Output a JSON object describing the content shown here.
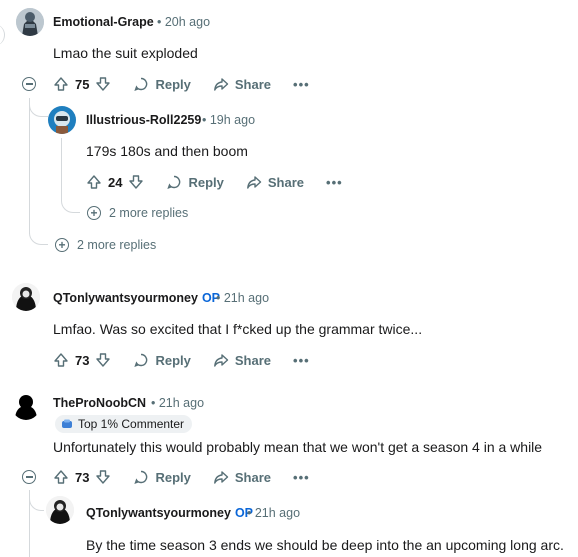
{
  "comments": [
    {
      "username": "Emotional-Grape",
      "meta": "• 20h ago",
      "body": "Lmao the suit exploded",
      "score": "75",
      "reply_label": "Reply",
      "share_label": "Share",
      "more_label": "•••"
    },
    {
      "username": "Illustrious-Roll2259",
      "meta": "• 19h ago",
      "body": "179s 180s and then boom",
      "score": "24",
      "reply_label": "Reply",
      "share_label": "Share",
      "more_label": "•••",
      "more_replies": "2 more replies"
    },
    {
      "more_replies": "2 more replies"
    },
    {
      "username": "QTonlywantsyourmoney",
      "op": "OP",
      "meta": "• 21h ago",
      "body": "Lmfao. Was so excited that I f*cked up the grammar twice...",
      "score": "73",
      "reply_label": "Reply",
      "share_label": "Share",
      "more_label": "•••"
    },
    {
      "username": "TheProNoobCN",
      "meta": "• 21h ago",
      "badge": "Top 1% Commenter",
      "body": "Unfortunately this would probably mean that we won't get a season 4 in a while",
      "score": "73",
      "reply_label": "Reply",
      "share_label": "Share",
      "more_label": "•••"
    },
    {
      "username": "QTonlywantsyourmoney",
      "op": "OP",
      "meta": "• 21h ago",
      "body": "By the time season 3 ends we should be deep into the an upcoming long arc."
    }
  ]
}
